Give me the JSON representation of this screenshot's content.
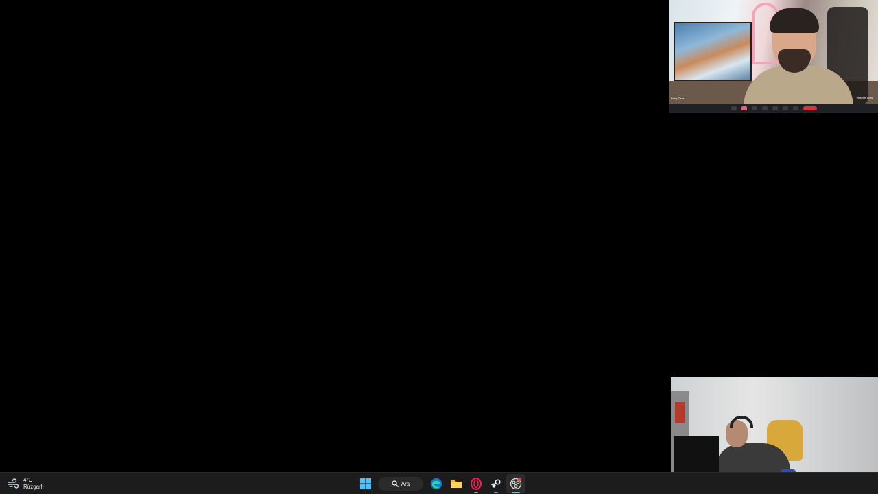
{
  "call_overlay": {
    "left_participant": "Barış Özcer",
    "right_participant": "Hüseyin Ateş",
    "corner_glyph": "ᵊ"
  },
  "taskbar": {
    "weather": {
      "temperature": "4°C",
      "condition": "Rüzgarlı",
      "icon": "windy-weather-icon"
    },
    "search": {
      "label": "Ara",
      "icon": "search-icon"
    },
    "apps": [
      {
        "name": "start",
        "icon": "windows-start-icon"
      },
      {
        "name": "edge",
        "icon": "edge-browser-icon"
      },
      {
        "name": "file-explorer",
        "icon": "folder-icon"
      },
      {
        "name": "opera-gx",
        "icon": "opera-gx-icon"
      },
      {
        "name": "steam",
        "icon": "steam-icon"
      },
      {
        "name": "obs",
        "icon": "recording-app-icon"
      }
    ],
    "accent_color": "#4cc2ff",
    "background_color": "#1c1c1c"
  }
}
